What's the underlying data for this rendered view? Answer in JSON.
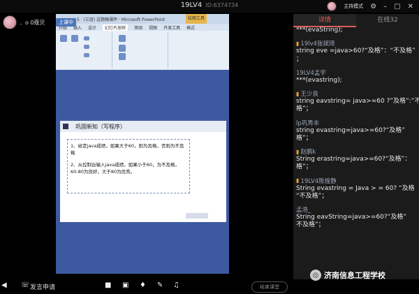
{
  "header": {
    "room_name": "19LV4",
    "room_id": "ID:6374734",
    "mode_label": "主持模式"
  },
  "left": {
    "username": "．o  0蔻贝",
    "cam_label": "上课中"
  },
  "ppt": {
    "window_title": "5 · (三班) 这题稿课件 · Microsoft PowerPoint",
    "tools_label": "绘图工具",
    "tabs": [
      "开始",
      "插入",
      "设计",
      "幻灯片放映",
      "审阅",
      "视图",
      "开发工具",
      "格式"
    ],
    "active_tab": "幻灯片放映",
    "slide_title": "巩固新知（写程序）",
    "slide_text": [
      "1、给定java成绩，如果大于60，则为及格，否则为不及格",
      "2、从控制台输入java成绩，如果小于60，为不及格，60-80为良好，大于80为优秀。"
    ]
  },
  "panel": {
    "tabs": [
      {
        "label": "详情",
        "active": true
      },
      {
        "label": "在线32",
        "active": false
      }
    ],
    "messages": [
      {
        "user": "",
        "text": [
          "***(evaString);"
        ]
      },
      {
        "user": "19lv4张斌琦",
        "text": [
          "string eve =java>60?“及格”：“不及格”",
          "；"
        ]
      },
      {
        "user": "19LV4孟宇",
        "text": [
          "***(evastring);"
        ]
      },
      {
        "user": "王少良",
        "text": [
          "string eavstring= java>=60 ?”及格”:”不",
          "格”；"
        ]
      },
      {
        "user": "lp巩秀丰",
        "text": [
          "string evastring=java>=60?“及格”",
          "格”；"
        ]
      },
      {
        "user": "赵鹏k",
        "text": [
          "String erastring=java>=60?“及格”：",
          "格”；"
        ]
      },
      {
        "user": "19LV4陈煌静",
        "text": [
          "String evastring = Java > = 60?  “及格",
          "“不及格”；"
        ]
      },
      {
        "user": "孟浩_",
        "text": [
          "String eavString=java>=60?“及格”",
          "不及格”；"
        ]
      }
    ]
  },
  "bottom": {
    "apply_label": "发言申请",
    "end_label": "结束课堂"
  },
  "watermark": "济南信息工程学校"
}
